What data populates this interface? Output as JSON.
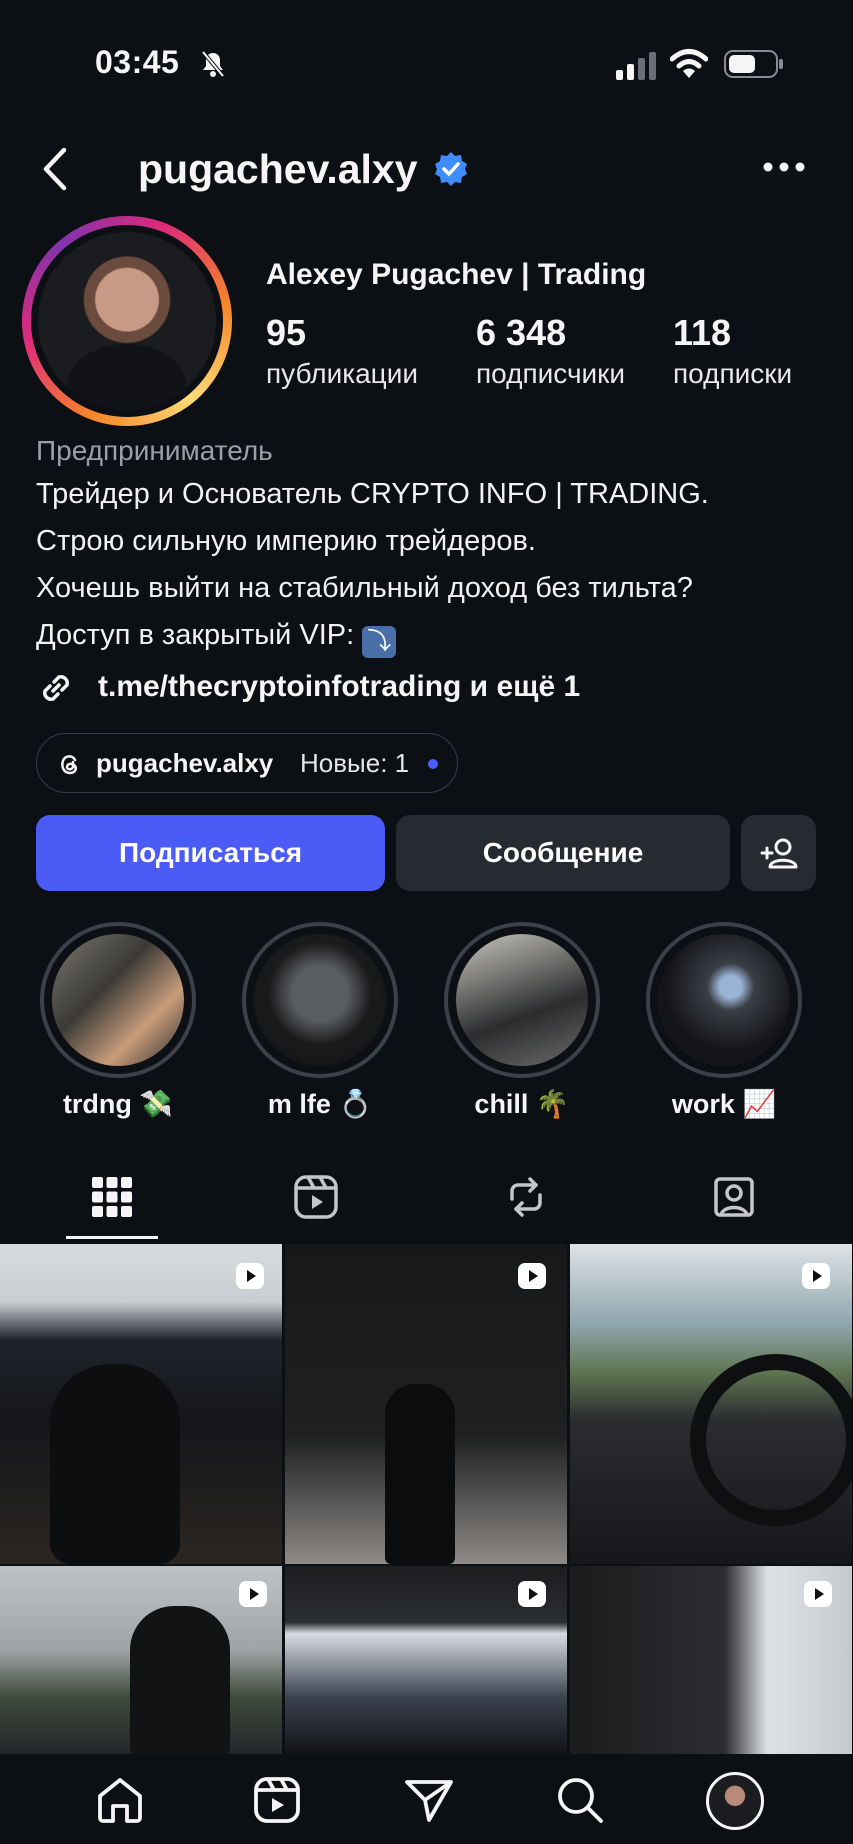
{
  "status_bar": {
    "time": "03:45"
  },
  "header": {
    "username": "pugachev.alxy"
  },
  "profile": {
    "display_name": "Alexey Pugachev | Trading",
    "stats": [
      {
        "value": "95",
        "label": "публикации"
      },
      {
        "value": "6 348",
        "label": "подписчики"
      },
      {
        "value": "118",
        "label": "подписки"
      }
    ],
    "category": "Предприниматель",
    "bio_lines": [
      "Трейдер и Основатель CRYPTO INFO | TRADING.",
      "Строю сильную империю трейдеров.",
      "Хочешь выйти на стабильный доход без тильта?",
      "Доступ в закрытый VIP:"
    ],
    "bio_emoji": "⤵",
    "link_text": "t.me/thecryptoinfotrading и ещё 1",
    "threads": {
      "name": "pugachev.alxy",
      "new_label": "Новые: 1"
    }
  },
  "actions": {
    "follow_label": "Подписаться",
    "message_label": "Сообщение"
  },
  "highlights": [
    {
      "label": "trdng 💸"
    },
    {
      "label": "m lfe 💍"
    },
    {
      "label": "chill 🌴"
    },
    {
      "label": "work 📈"
    }
  ],
  "tabs": [
    "grid-icon",
    "reels-icon",
    "reposts-icon",
    "tagged-icon"
  ],
  "colors": {
    "background": "#0c0f14",
    "follow_button": "#4a5cf5",
    "verified": "#3f8cff"
  },
  "bottom_nav": [
    "home-icon",
    "reels-icon",
    "direct-icon",
    "search-icon",
    "profile-avatar"
  ]
}
